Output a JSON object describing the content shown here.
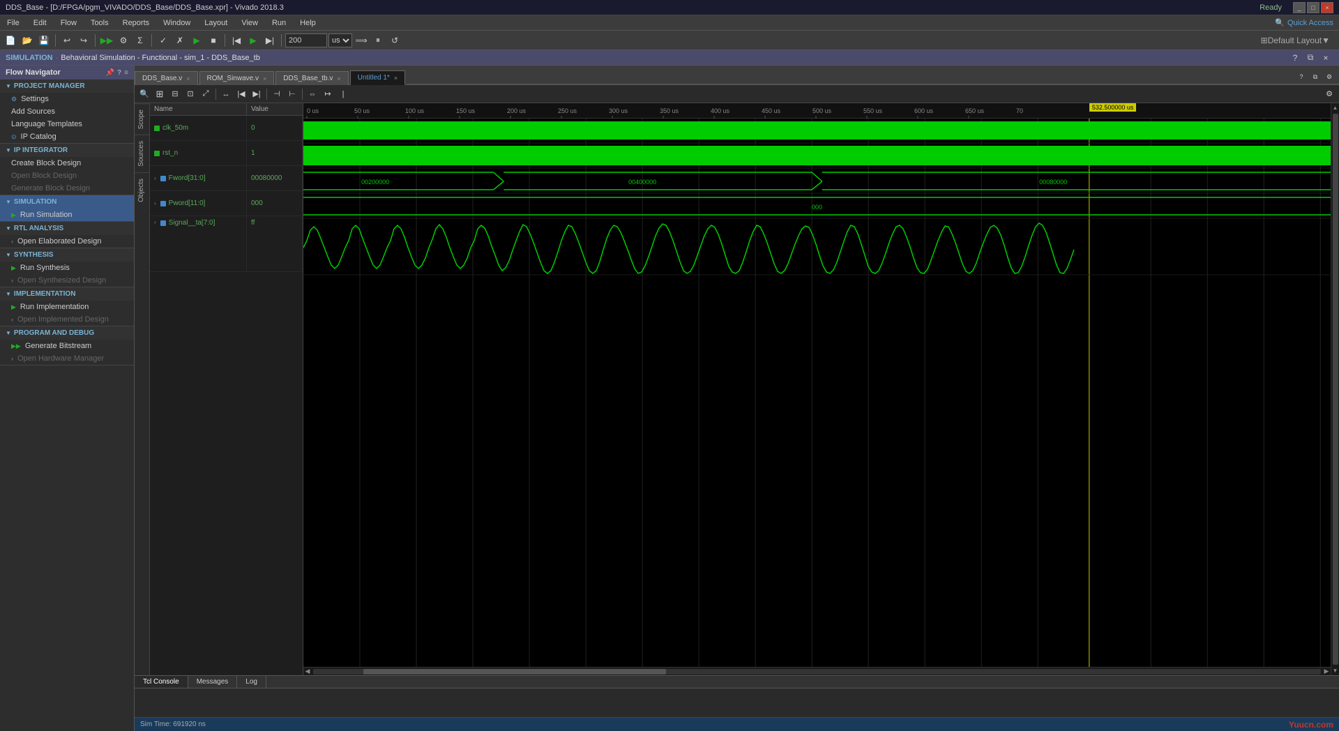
{
  "titlebar": {
    "title": "DDS_Base - [D:/FPGA/pgm_VIVADO/DDS_Base/DDS_Base.xpr] - Vivado 2018.3",
    "status": "Ready",
    "controls": [
      "_",
      "□",
      "×"
    ]
  },
  "menubar": {
    "items": [
      "File",
      "Edit",
      "Flow",
      "Tools",
      "Reports",
      "Window",
      "Layout",
      "View",
      "Run",
      "Help"
    ]
  },
  "toolbar": {
    "quick_access_label": "Quick Access",
    "time_value": "200",
    "time_unit": "us",
    "default_layout": "Default Layout"
  },
  "simulation_bar": {
    "label": "SIMULATION",
    "description": "Behavioral Simulation - Functional - sim_1 - DDS_Base_tb"
  },
  "flow_navigator": {
    "title": "Flow Navigator",
    "sections": {
      "project_manager": {
        "label": "PROJECT MANAGER",
        "items": [
          "Settings",
          "Add Sources",
          "Language Templates",
          "IP Catalog"
        ]
      },
      "ip_integrator": {
        "label": "IP INTEGRATOR",
        "items": [
          "Create Block Design",
          "Open Block Design",
          "Generate Block Design"
        ]
      },
      "simulation": {
        "label": "SIMULATION",
        "items": [
          "Run Simulation"
        ]
      },
      "rtl_analysis": {
        "label": "RTL ANALYSIS",
        "items": [
          "Open Elaborated Design"
        ]
      },
      "synthesis": {
        "label": "SYNTHESIS",
        "items": [
          "Run Synthesis",
          "Open Synthesized Design"
        ]
      },
      "implementation": {
        "label": "IMPLEMENTATION",
        "items": [
          "Run Implementation",
          "Open Implemented Design"
        ]
      },
      "program_debug": {
        "label": "PROGRAM AND DEBUG",
        "items": [
          "Generate Bitstream",
          "Open Hardware Manager"
        ]
      }
    }
  },
  "tabs": [
    {
      "label": "DDS_Base.v",
      "active": false,
      "closeable": true
    },
    {
      "label": "ROM_Sinwave.v",
      "active": false,
      "closeable": true
    },
    {
      "label": "DDS_Base_tb.v",
      "active": false,
      "closeable": true
    },
    {
      "label": "Untitled 1*",
      "active": true,
      "closeable": true,
      "modified": true
    }
  ],
  "signals": [
    {
      "name": "clk_50m",
      "value": "0",
      "type": "wire",
      "height": "small"
    },
    {
      "name": "rst_n",
      "value": "1",
      "type": "wire",
      "height": "small"
    },
    {
      "name": "Fword[31:0]",
      "value": "00080000",
      "type": "bus",
      "height": "small"
    },
    {
      "name": "Pword[11:0]",
      "value": "000",
      "type": "bus",
      "height": "small"
    },
    {
      "name": "Signal__ta[7:0]",
      "value": "ff",
      "type": "bus",
      "height": "large"
    }
  ],
  "timeline": {
    "markers": [
      "0 us",
      "50 us",
      "100 us",
      "150 us",
      "200 us",
      "250 us",
      "300 us",
      "350 us",
      "400 us",
      "450 us",
      "500 us",
      "550 us",
      "600 us",
      "650 us",
      "70"
    ],
    "cursor_label": "532.500000 us",
    "cursor_position_pct": 77.5
  },
  "bus_values": {
    "fword_mid1": "00200000",
    "fword_mid2": "00400000",
    "fword_mid3": "00080000",
    "pword_mid": "000"
  },
  "bottom_tabs": [
    "Tcl Console",
    "Messages",
    "Log"
  ],
  "status_bottom": {
    "sim_time": "Sim Time: 691920 ns",
    "watermark": "Yuucn.com"
  },
  "sidebar_labels": [
    "Scope",
    "Sources",
    "Objects"
  ]
}
